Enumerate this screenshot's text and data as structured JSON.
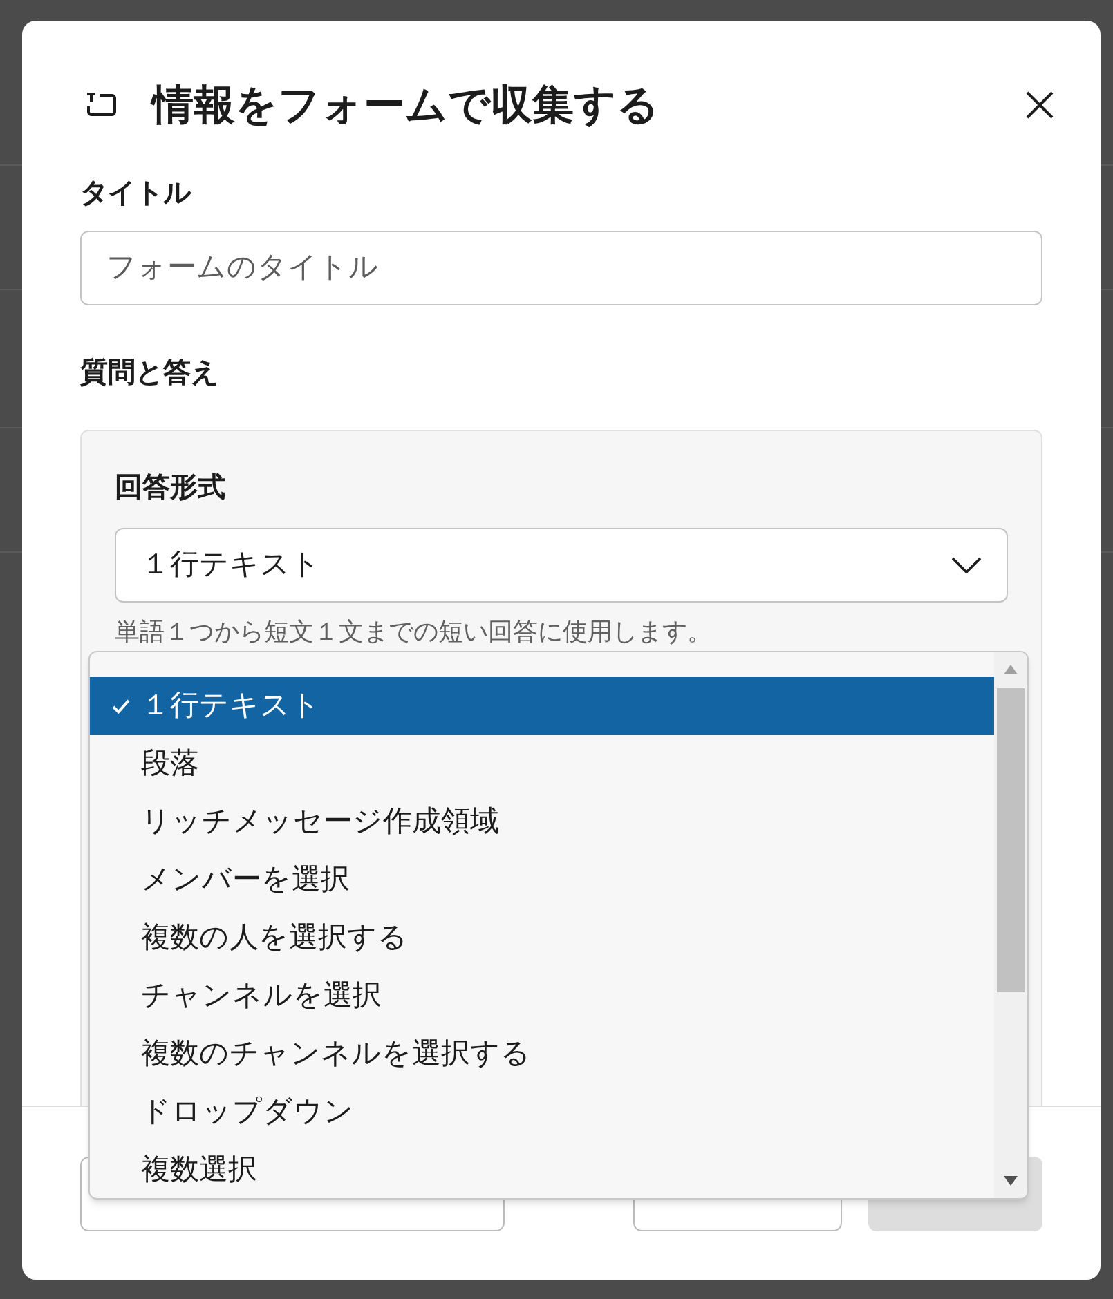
{
  "dialog": {
    "title": "情報をフォームで収集する"
  },
  "title_field": {
    "label": "タイトル",
    "placeholder": "フォームのタイトル"
  },
  "section": {
    "label": "質問と答え"
  },
  "question": {
    "label": "回答形式",
    "value": "１行テキスト",
    "hint": "単語１つから短文１文までの短い回答に使用します。"
  },
  "dropdown": {
    "options": [
      {
        "label": "１行テキスト",
        "selected": true
      },
      {
        "label": "段落",
        "selected": false
      },
      {
        "label": "リッチメッセージ作成領域",
        "selected": false
      },
      {
        "label": "メンバーを選択",
        "selected": false
      },
      {
        "label": "複数の人を選択する",
        "selected": false
      },
      {
        "label": "チャンネルを選択",
        "selected": false
      },
      {
        "label": "複数のチャンネルを選択する",
        "selected": false
      },
      {
        "label": "ドロップダウン",
        "selected": false
      },
      {
        "label": "複数選択",
        "selected": false
      }
    ]
  },
  "footer": {
    "buttons": [
      {
        "kind": "outline"
      },
      {
        "kind": "outline"
      },
      {
        "kind": "primary",
        "disabled": true
      }
    ]
  }
}
